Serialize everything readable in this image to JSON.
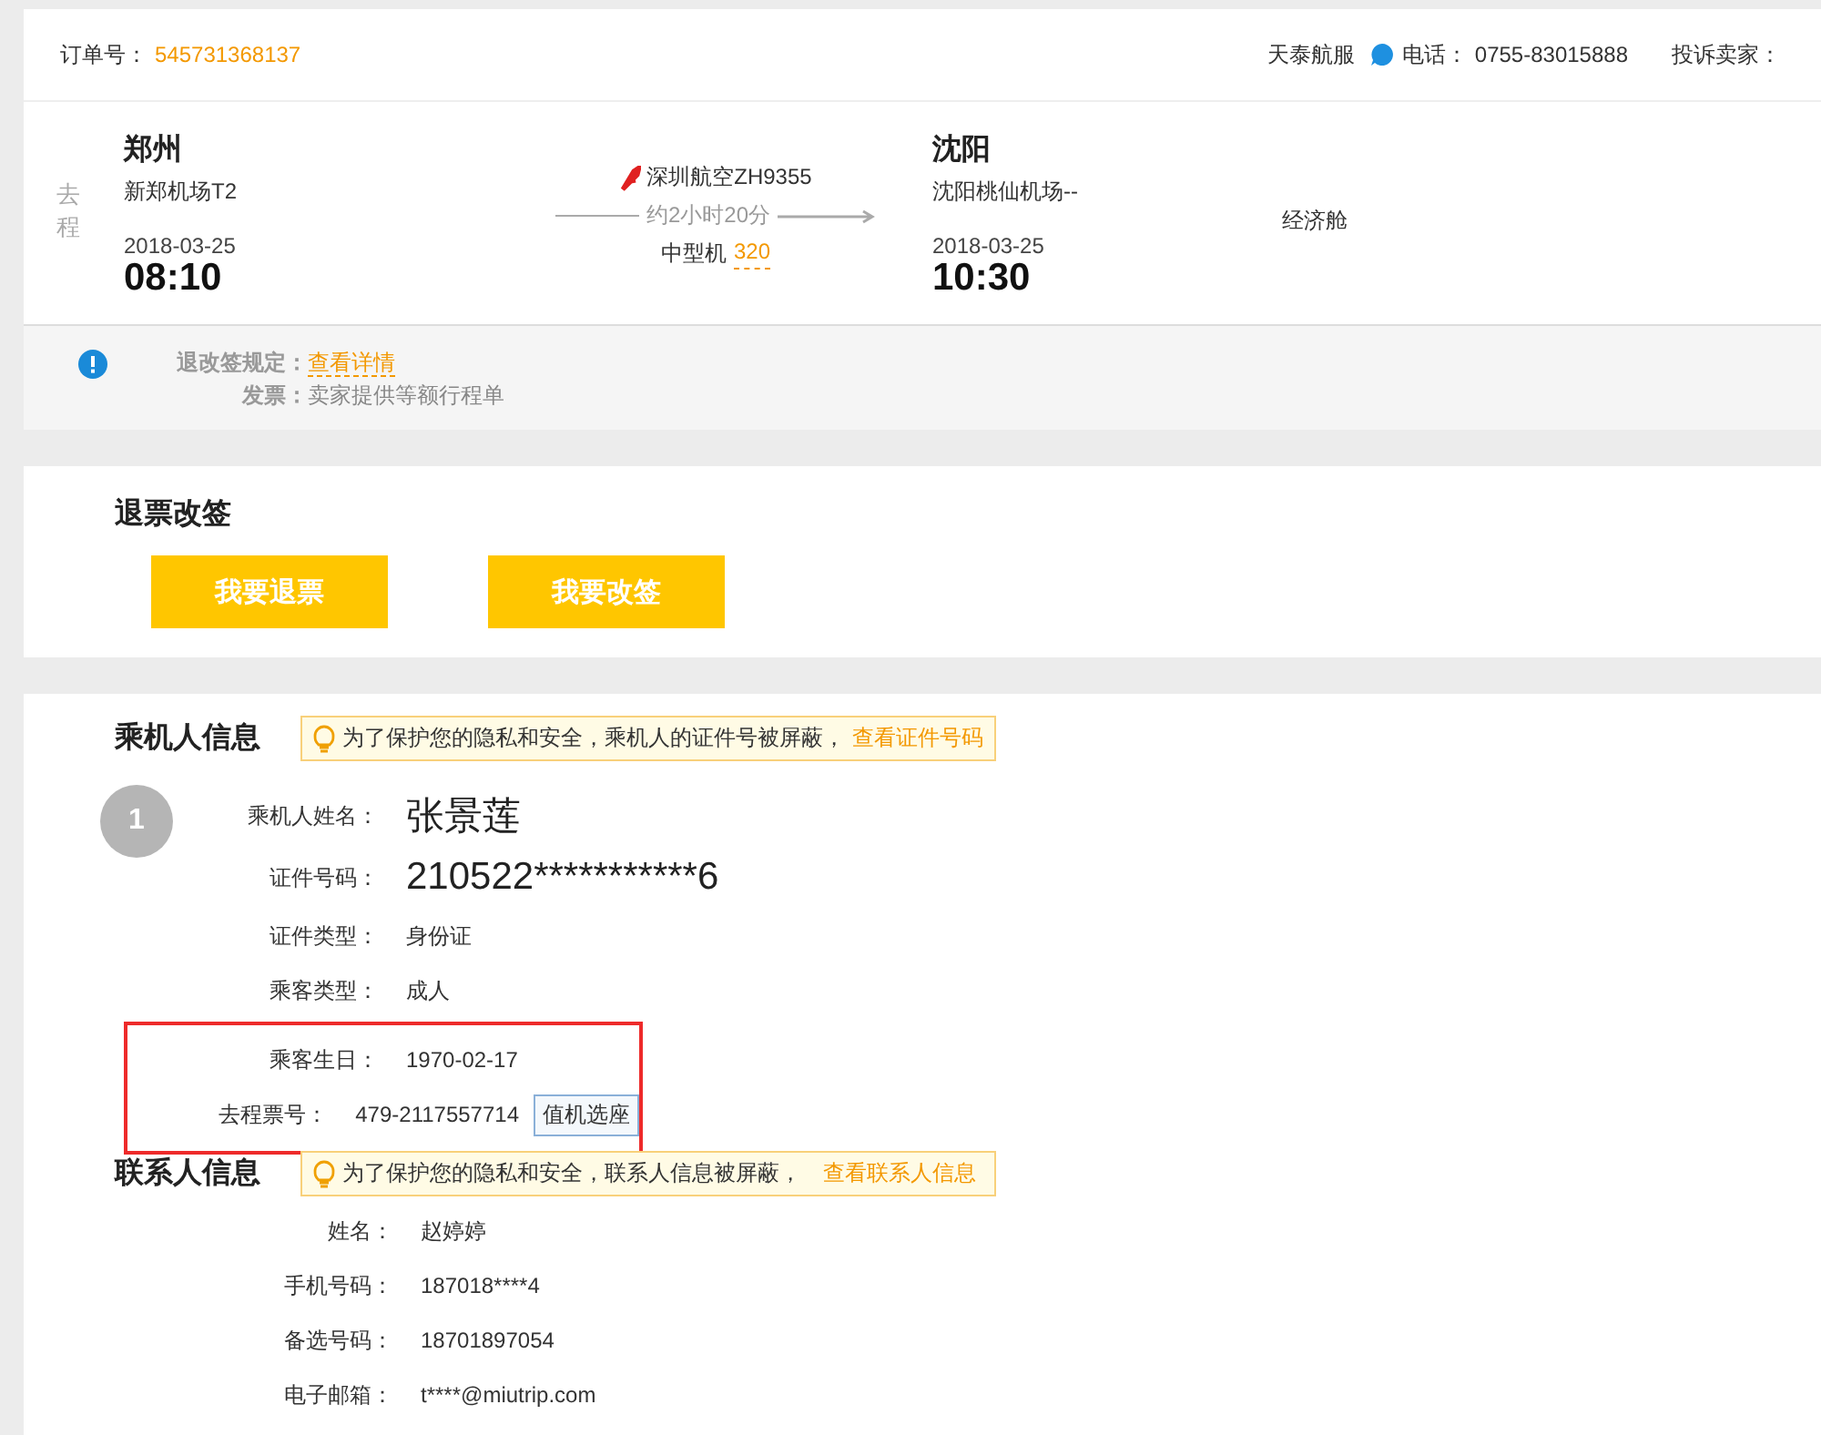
{
  "order": {
    "label": "订单号：",
    "number": "545731368137",
    "agency": "天泰航服",
    "phone_label": "电话：",
    "phone": "0755-83015888",
    "complaint": "投诉卖家："
  },
  "flight": {
    "direction": "去程",
    "from": {
      "city": "郑州",
      "airport": "新郑机场T2",
      "date": "2018-03-25",
      "time": "08:10"
    },
    "airline": "深圳航空ZH9355",
    "duration": "约2小时20分",
    "aircraft": "中型机",
    "aircraft_code": "320",
    "to": {
      "city": "沈阳",
      "airport": "沈阳桃仙机场--",
      "date": "2018-03-25",
      "time": "10:30"
    },
    "cabin": "经济舱"
  },
  "notice": {
    "rule_label": "退改签规定：",
    "rule_link": "查看详情",
    "invoice_label": "发票：",
    "invoice": "卖家提供等额行程单"
  },
  "refund": {
    "title": "退票改签",
    "buttons": [
      "我要退票",
      "我要改签"
    ]
  },
  "passenger": {
    "title": "乘机人信息",
    "tip": "为了保护您的隐私和安全，乘机人的证件号被屏蔽，",
    "tip_link": "查看证件号码",
    "index": "1",
    "fields": [
      {
        "label": "乘机人姓名：",
        "value": "张景莲",
        "kind": "large"
      },
      {
        "label": "证件号码：",
        "value": "210522***********6",
        "kind": "large"
      },
      {
        "label": "证件类型：",
        "value": "身份证",
        "kind": "plain"
      },
      {
        "label": "乘客类型：",
        "value": "成人",
        "kind": "plain"
      }
    ],
    "marked_fields": [
      {
        "label": "乘客生日：",
        "value": "1970-02-17"
      },
      {
        "label": "去程票号：",
        "value": "479-2117557714",
        "button": "值机选座"
      }
    ]
  },
  "contact": {
    "title": "联系人信息",
    "tip": "为了保护您的隐私和安全，联系人信息被屏蔽，",
    "tip_link": "查看联系人信息",
    "fields": [
      {
        "label": "姓名：",
        "value": "赵婷婷"
      },
      {
        "label": "手机号码：",
        "value": "187018****4"
      },
      {
        "label": "备选号码：",
        "value": "18701897054"
      },
      {
        "label": "电子邮箱：",
        "value": "t****@miutrip.com"
      }
    ]
  }
}
